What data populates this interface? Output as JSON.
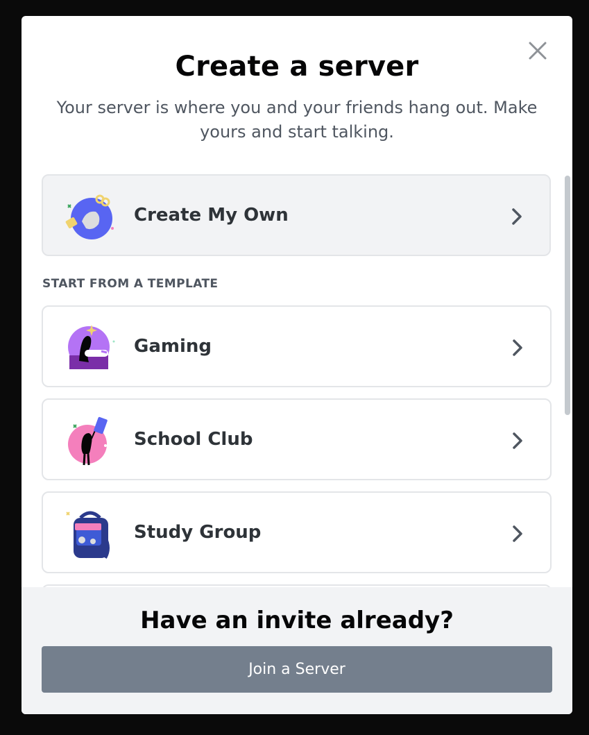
{
  "modal": {
    "title": "Create a server",
    "subtitle": "Your server is where you and your friends hang out. Make yours and start talking."
  },
  "create_own": {
    "label": "Create My Own",
    "icon": "create-own-illustration"
  },
  "templates": {
    "section_label": "START FROM A TEMPLATE",
    "items": [
      {
        "label": "Gaming",
        "icon": "gaming-illustration"
      },
      {
        "label": "School Club",
        "icon": "school-club-illustration"
      },
      {
        "label": "Study Group",
        "icon": "study-group-illustration"
      }
    ]
  },
  "footer": {
    "title": "Have an invite already?",
    "join_label": "Join a Server"
  },
  "colors": {
    "accent_blue": "#5865f2",
    "join_button": "#747f8d",
    "gaming_purple": "#b473f5",
    "school_pink": "#f47fbc",
    "study_navy": "#2b3a8c"
  }
}
